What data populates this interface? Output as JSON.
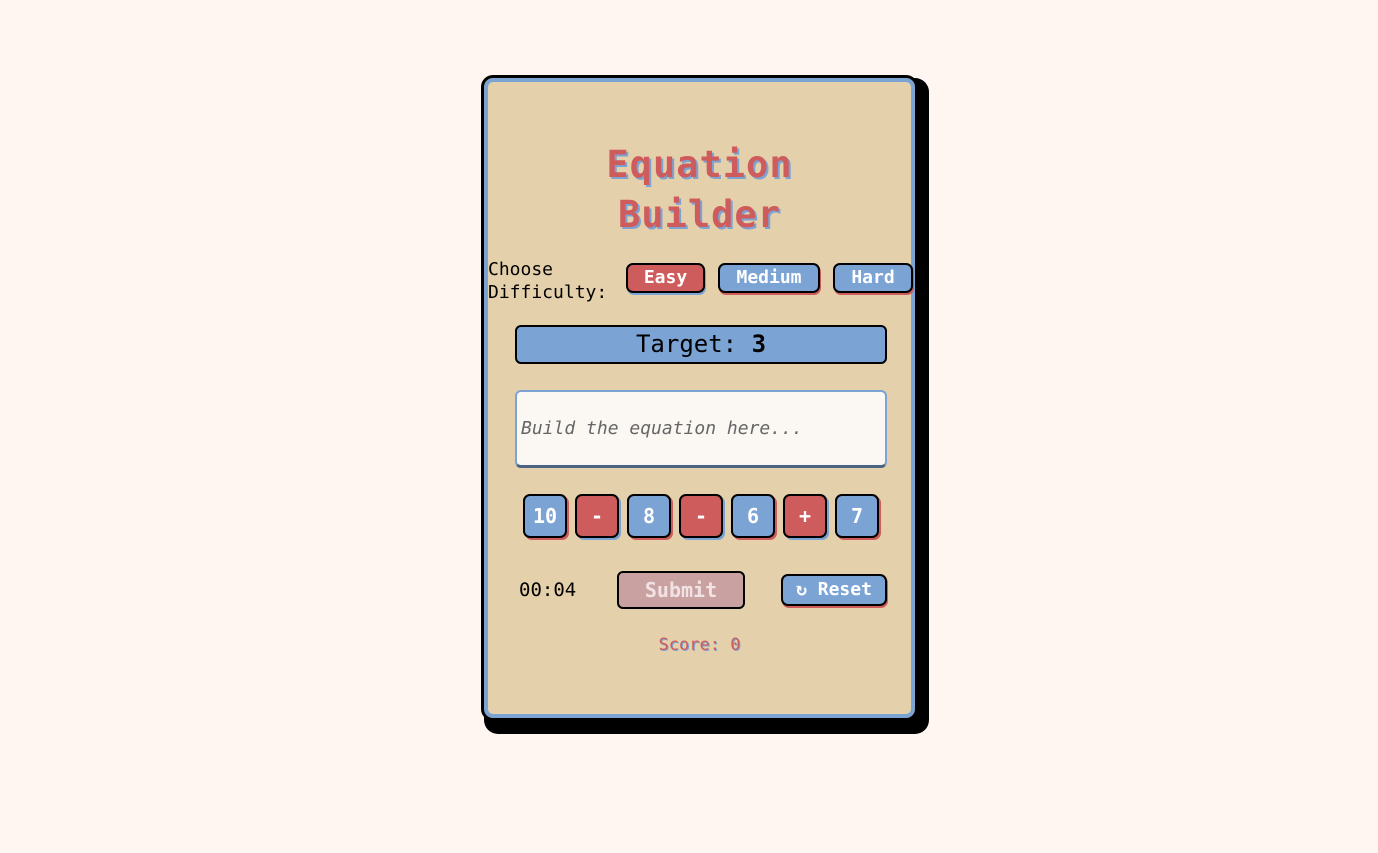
{
  "game": {
    "title_line1": "Equation",
    "title_line2": "Builder",
    "difficulty_label_line1": "Choose",
    "difficulty_label_line2": "Difficulty:",
    "difficulty": {
      "options": [
        "Easy",
        "Medium",
        "Hard"
      ],
      "selected": "Easy"
    },
    "target_label": "Target:",
    "target_value": "3",
    "equation_placeholder": "Build the equation here...",
    "equation_value": "",
    "tiles": [
      "10",
      "-",
      "8",
      "-",
      "6",
      "+",
      "7"
    ],
    "timer": "00:04",
    "submit_label": "Submit",
    "reset_icon": "↻",
    "reset_label": "Reset",
    "score_label": "Score:",
    "score_value": "0"
  },
  "colors": {
    "background": "#fff6f1",
    "card": "#e4d0aa",
    "primary_blue": "#7ba3d4",
    "accent_red": "#cf5c5c",
    "submit_disabled": "#c9a1a1"
  }
}
